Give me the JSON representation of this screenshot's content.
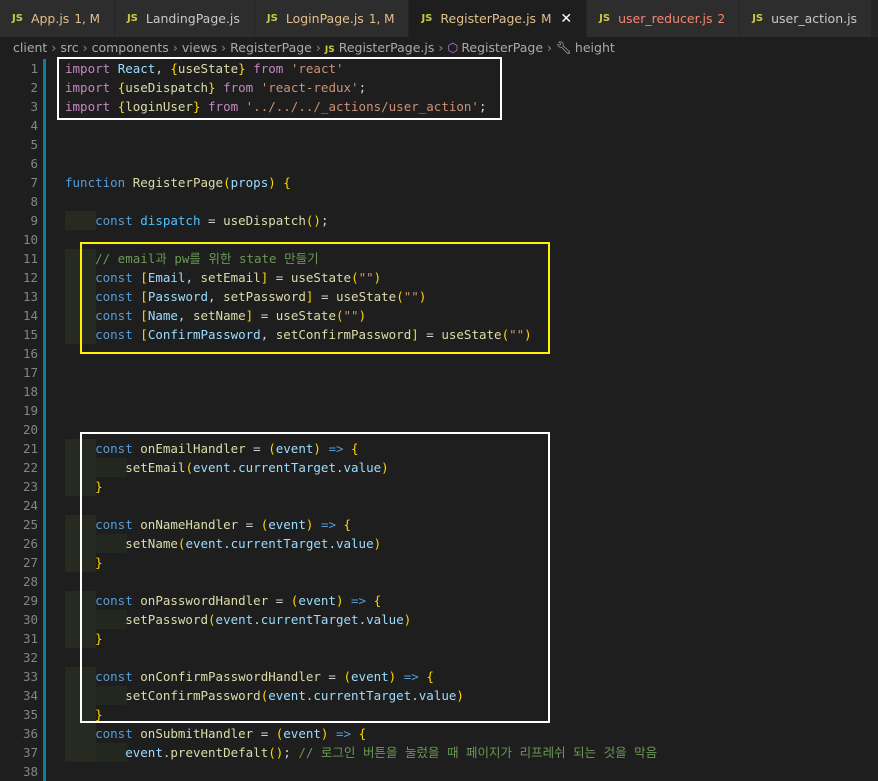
{
  "tabs": [
    {
      "label": "App.js",
      "status": "1, M",
      "state": "mod"
    },
    {
      "label": "LandingPage.js",
      "status": "",
      "state": ""
    },
    {
      "label": "LoginPage.js",
      "status": "1, M",
      "state": "mod"
    },
    {
      "label": "RegisterPage.js",
      "status": "M",
      "state": "active"
    },
    {
      "label": "user_reducer.js",
      "status": "2",
      "state": "err"
    },
    {
      "label": "user_action.js",
      "status": "",
      "state": ""
    }
  ],
  "file_icon_label": "JS",
  "close_glyph": "✕",
  "breadcrumb": [
    "client",
    "src",
    "components",
    "views",
    "RegisterPage",
    "RegisterPage.js",
    "RegisterPage",
    "height"
  ],
  "line_numbers": [
    "1",
    "2",
    "3",
    "4",
    "5",
    "6",
    "7",
    "8",
    "9",
    "10",
    "11",
    "12",
    "13",
    "14",
    "15",
    "16",
    "17",
    "18",
    "19",
    "20",
    "21",
    "22",
    "23",
    "24",
    "25",
    "26",
    "27",
    "28",
    "29",
    "30",
    "31",
    "32",
    "33",
    "34",
    "35",
    "36",
    "37",
    "38"
  ],
  "code_lines": [
    "import React, {useState} from 'react'",
    "import {useDispatch} from 'react-redux';",
    "import {loginUser} from '../../../_actions/user_action';",
    "",
    "",
    "",
    "function RegisterPage(props) {",
    "",
    "    const dispatch = useDispatch();",
    "",
    "    // email과 pw를 위한 state 만들기",
    "    const [Email, setEmail] = useState(\"\")",
    "    const [Password, setPassword] = useState(\"\")",
    "    const [Name, setName] = useState(\"\")",
    "    const [ConfirmPassword, setConfirmPassword] = useState(\"\")",
    "",
    "",
    "",
    "",
    "",
    "    const onEmailHandler = (event) => {",
    "        setEmail(event.currentTarget.value)",
    "    }",
    "",
    "    const onNameHandler = (event) => {",
    "        setName(event.currentTarget.value)",
    "    }",
    "",
    "    const onPasswordHandler = (event) => {",
    "        setPassword(event.currentTarget.value)",
    "    }",
    "",
    "    const onConfirmPasswordHandler = (event) => {",
    "        setConfirmPassword(event.currentTarget.value)",
    "    }",
    "    const onSubmitHandler = (event) => {",
    "        event.preventDefalt(); // 로그인 버튼을 눌렀을 때 페이지가 리프레쉬 되는 것을 막음",
    ""
  ],
  "colors": {
    "editor_bg": "#1e1e1e",
    "keyword": "#569cd6",
    "import_keyword": "#c586c0",
    "function": "#dcdcaa",
    "string": "#ce9178",
    "variable": "#9cdcfe",
    "comment": "#6a9955",
    "highlight_white": "#ffffff",
    "highlight_yellow": "#fff200"
  },
  "icons": {
    "breadcrumb_component": "cube-icon",
    "breadcrumb_property": "wrench-icon"
  }
}
